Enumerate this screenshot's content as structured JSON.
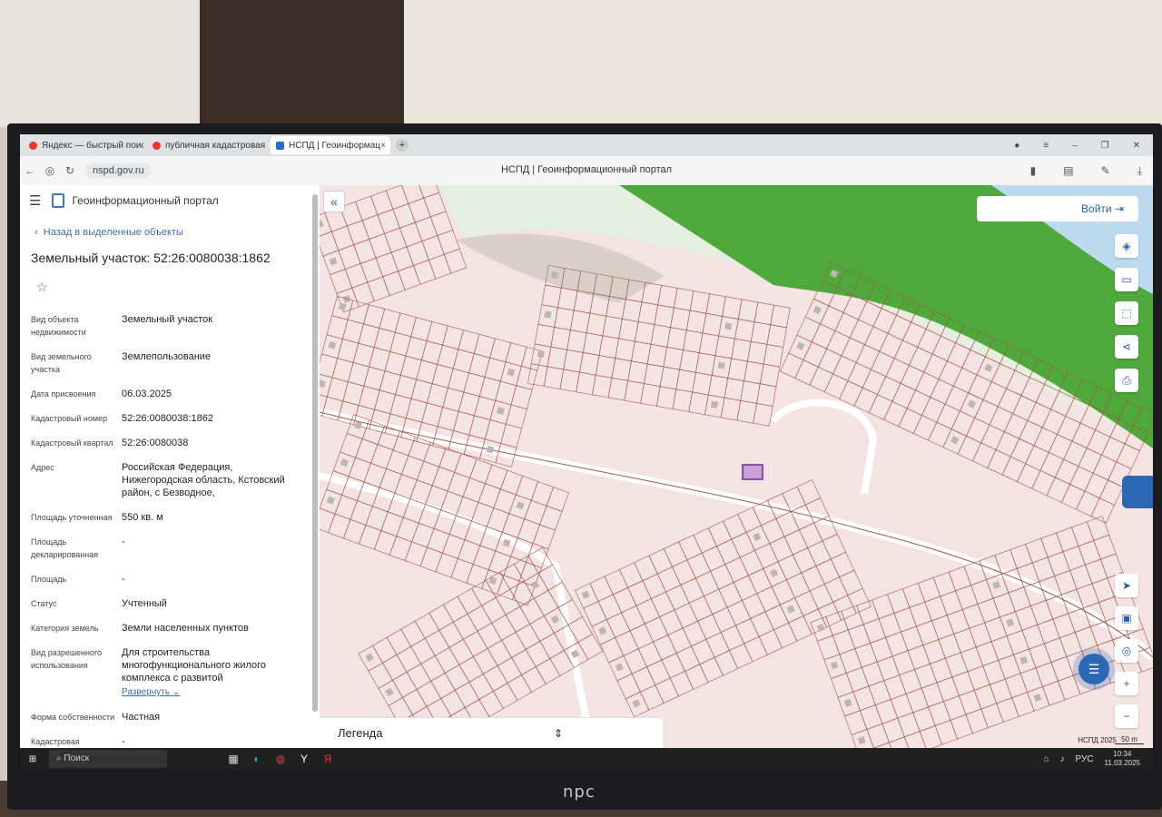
{
  "browser": {
    "tabs": [
      {
        "label": "Яндекс — быстрый поиск"
      },
      {
        "label": "публичная кадастровая к"
      },
      {
        "label": "НСПД | Геоинформац"
      }
    ],
    "close_glyph": "×",
    "new_tab_glyph": "+",
    "url": "nspd.gov.ru",
    "window_title": "НСПД | Геоинформационный портал"
  },
  "panel": {
    "portal_title": "Геоинформационный портал",
    "back_link": "Назад в выделенные объекты",
    "object_title": "Земельный участок: 52:26:0080038:1862",
    "rows": [
      {
        "key": "Вид объекта недвижимости",
        "value": "Земельный участок"
      },
      {
        "key": "Вид земельного участка",
        "value": "Землепользование"
      },
      {
        "key": "Дата присвоения",
        "value": "06.03.2025"
      },
      {
        "key": "Кадастровый номер",
        "value": "52:26:0080038:1862"
      },
      {
        "key": "Кадастровый квартал",
        "value": "52:26:0080038"
      },
      {
        "key": "Адрес",
        "value": "Российская Федерация, Нижегородская область, Кстовский район, с Безводное,"
      },
      {
        "key": "Площадь уточненная",
        "value": "550 кв. м"
      },
      {
        "key": "Площадь декларированная",
        "value": "-"
      },
      {
        "key": "Площадь",
        "value": "-"
      },
      {
        "key": "Статус",
        "value": "Учтенный"
      },
      {
        "key": "Категория земель",
        "value": "Земли населенных пунктов"
      },
      {
        "key": "Вид разрешенного использования",
        "value": "Для строительства многофункционального жилого комплекса с развитой"
      },
      {
        "key": "Форма собственности",
        "value": "Частная"
      },
      {
        "key": "Кадастровая",
        "value": "-"
      }
    ],
    "expand_link": "Развернуть"
  },
  "map": {
    "login_label": "Войти",
    "legend_label": "Легенда",
    "copyright": "НСПД 2025",
    "scale": "50 m",
    "colors": {
      "forest": "#4ea83a",
      "water": "#bcd9ee",
      "parcel_line": "#a55a4a",
      "selected": "#c9a0d8"
    }
  },
  "taskbar": {
    "search_placeholder": "Поиск",
    "lang": "РУС",
    "time": "10:34",
    "date": "11.03.2025"
  },
  "monitor_brand": "npc"
}
